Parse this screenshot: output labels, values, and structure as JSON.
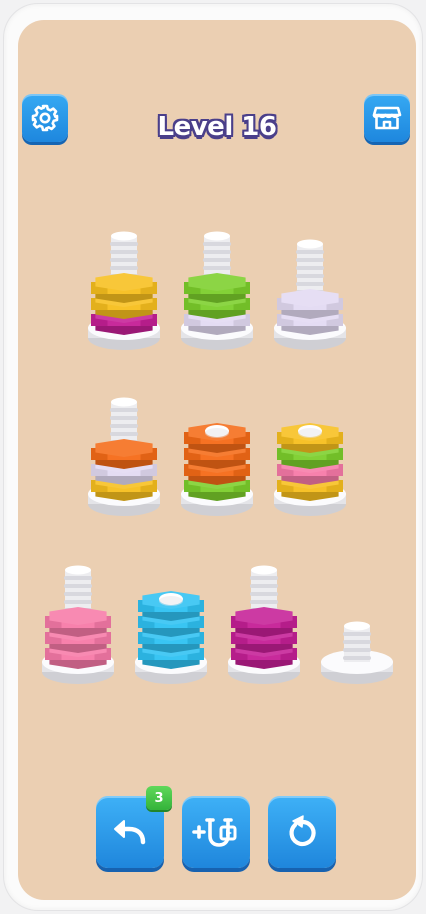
{
  "header": {
    "level_title": "Level 16",
    "settings_icon": "gear-icon",
    "shop_icon": "shop-icon"
  },
  "colors": {
    "background": "#ebcfb2",
    "yellow": "#f7bf1e",
    "magenta": "#c51f96",
    "green": "#7ccf2c",
    "lavender": "#e3daf2",
    "orange": "#f56b17",
    "pink": "#f77aa8",
    "cyan": "#2fc2f2",
    "button_blue": "#2a98e9",
    "badge_green": "#47c14a"
  },
  "board": {
    "rows": [
      [
        {
          "nuts": [
            "magenta",
            "yellow",
            "yellow"
          ],
          "capped": false
        },
        {
          "nuts": [
            "lavender",
            "green",
            "green"
          ],
          "capped": false
        },
        {
          "nuts": [
            "lavender",
            "lavender"
          ],
          "capped": false
        }
      ],
      [
        {
          "nuts": [
            "yellow",
            "lavender",
            "orange"
          ],
          "capped": false
        },
        {
          "nuts": [
            "green",
            "orange",
            "orange",
            "orange"
          ],
          "capped": true
        },
        {
          "nuts": [
            "yellow",
            "pink",
            "green",
            "yellow"
          ],
          "capped": true
        }
      ],
      [
        {
          "nuts": [
            "pink",
            "pink",
            "pink"
          ],
          "capped": false
        },
        {
          "nuts": [
            "cyan",
            "cyan",
            "cyan",
            "cyan"
          ],
          "capped": true
        },
        {
          "nuts": [
            "magenta",
            "magenta",
            "magenta"
          ],
          "capped": false
        },
        {
          "nuts": [],
          "capped": false
        }
      ]
    ]
  },
  "controls": {
    "undo_count": "3",
    "undo_icon": "undo-icon",
    "add_bolt_icon": "add-bolt-video-icon",
    "restart_icon": "restart-icon"
  }
}
